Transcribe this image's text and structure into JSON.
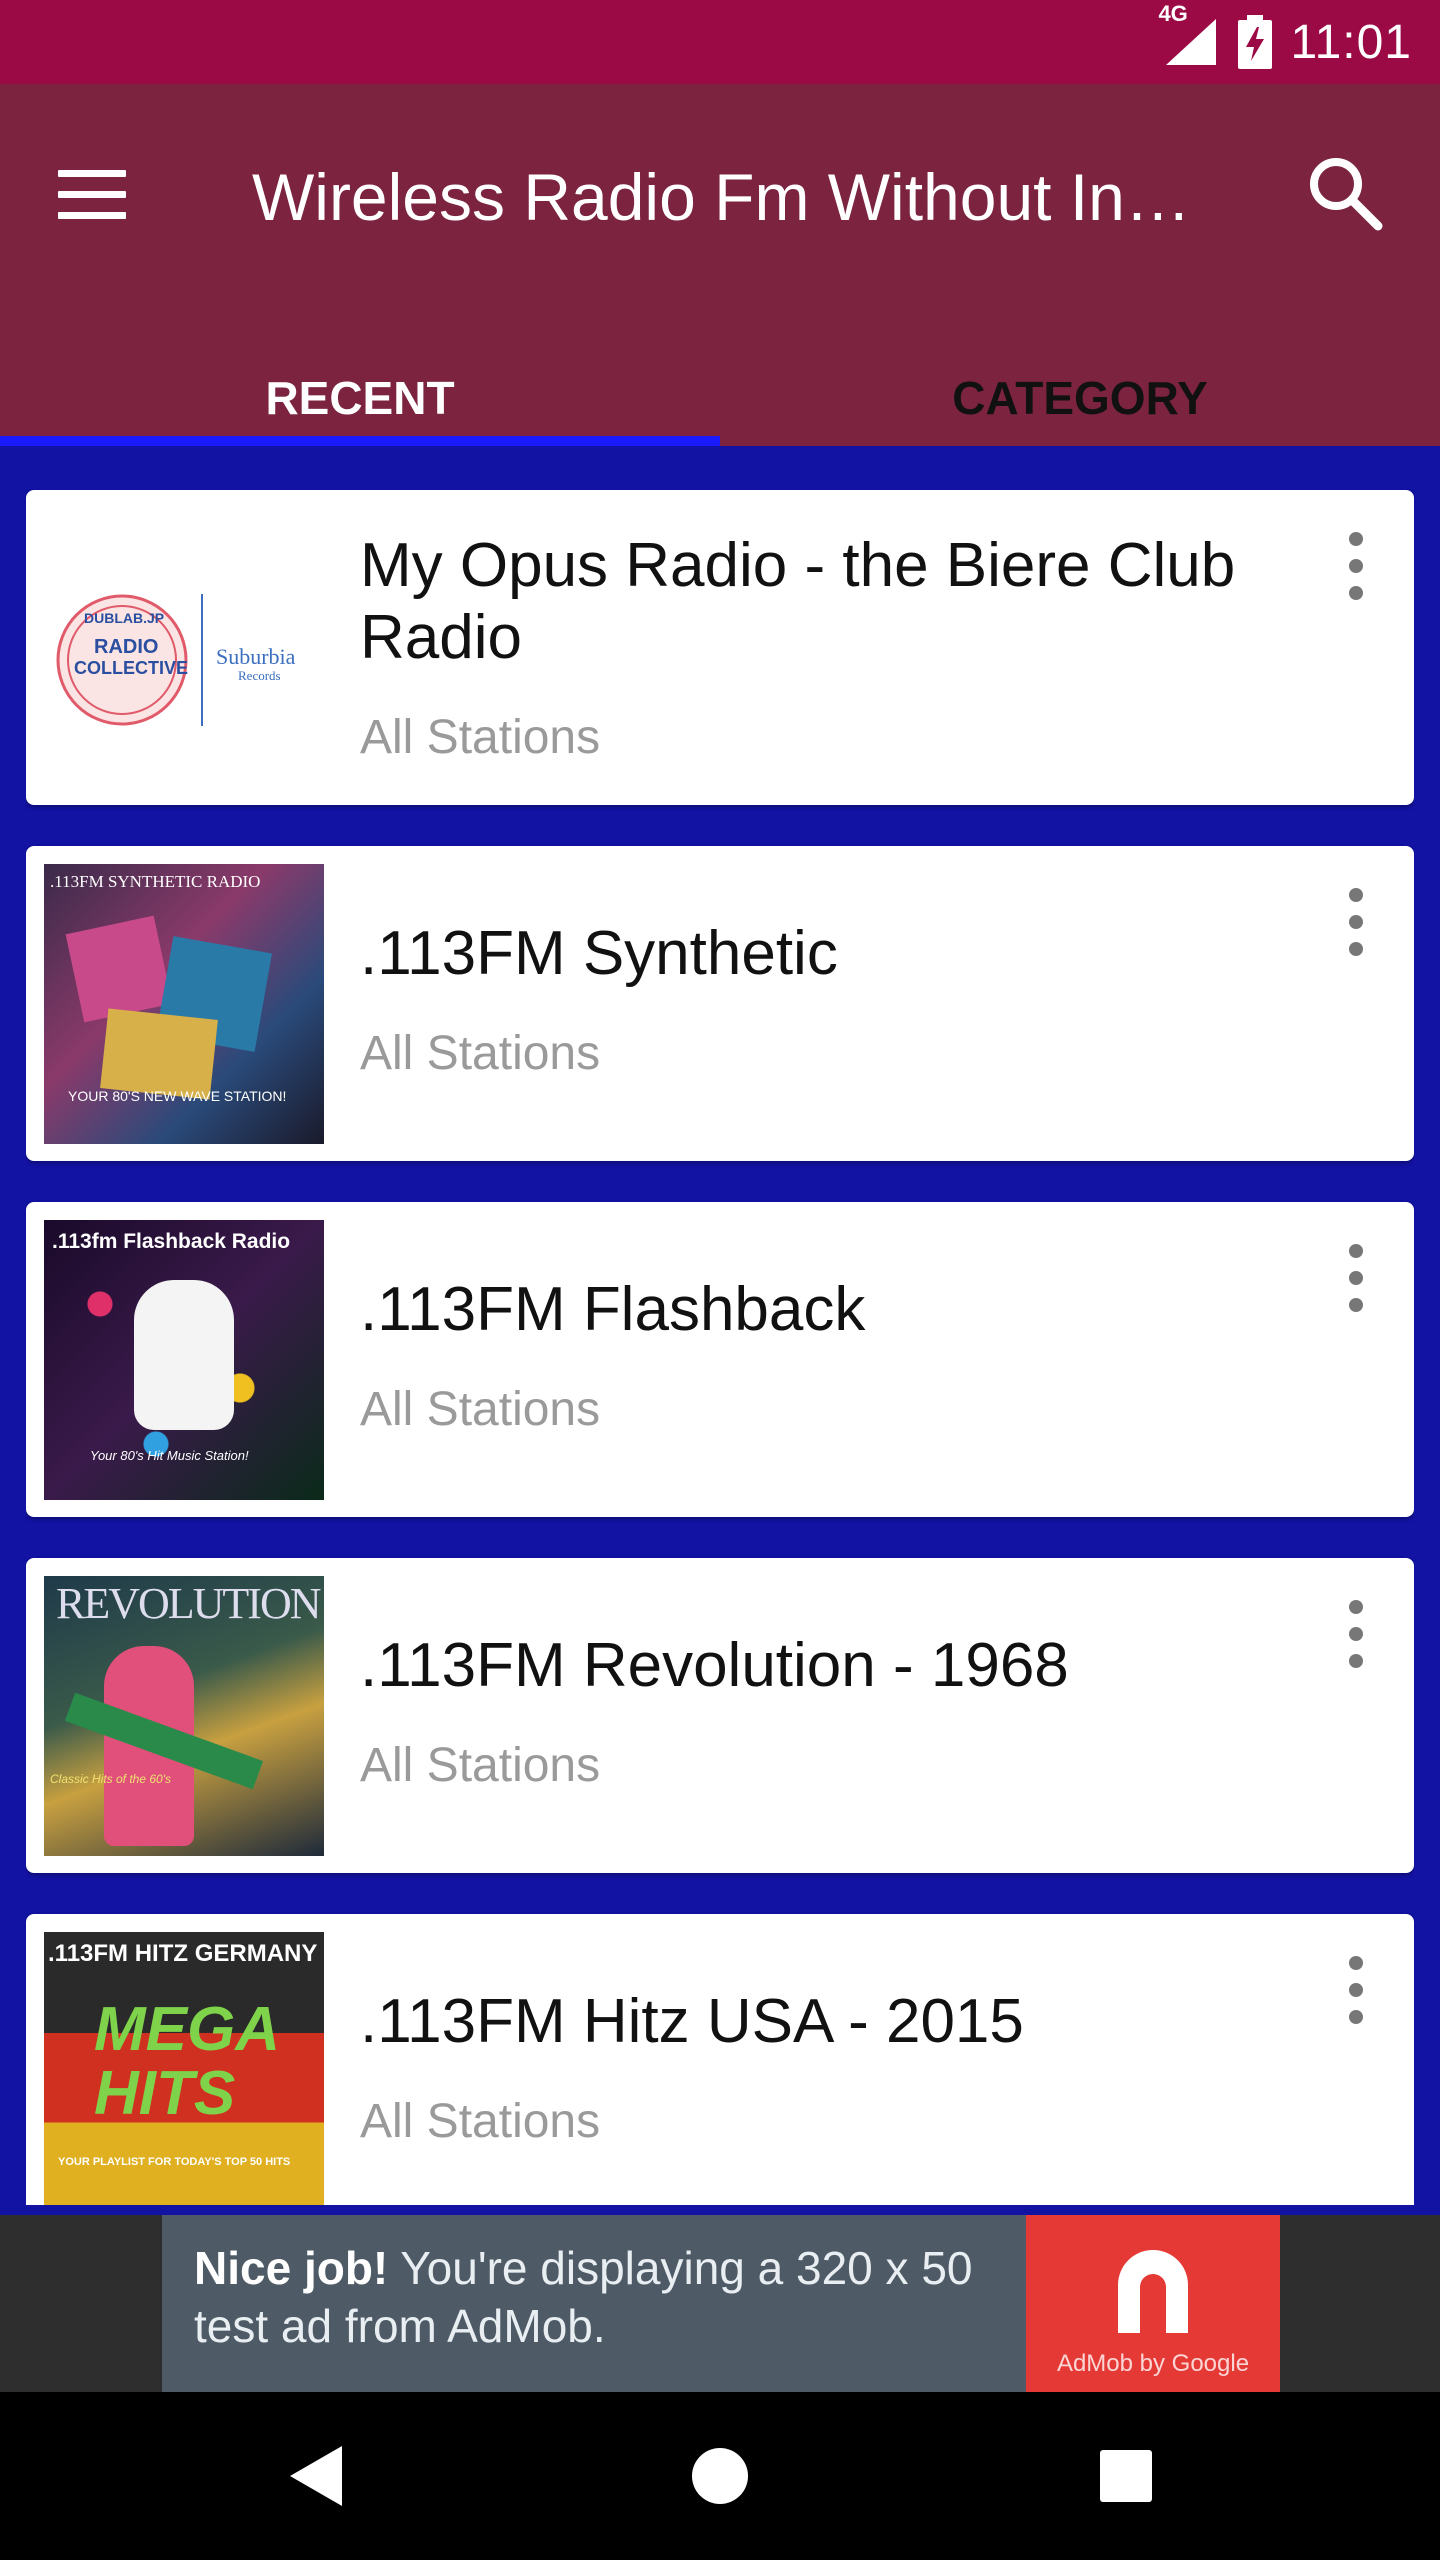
{
  "status_bar": {
    "network": "4G",
    "time": "11:01",
    "icons": [
      "signal-icon",
      "battery-charging-icon"
    ]
  },
  "app_bar": {
    "title": "Wireless Radio Fm Without In…",
    "menu_icon": "hamburger-menu-icon",
    "search_icon": "search-icon"
  },
  "tabs": [
    {
      "label": "RECENT",
      "selected": true
    },
    {
      "label": "CATEGORY",
      "selected": false
    }
  ],
  "stations": [
    {
      "title": "My Opus Radio - the Biere Club Radio",
      "subtitle": "All Stations",
      "thumb_text": "",
      "logo_text_1": "DUBLAB.JP",
      "logo_text_2": "RADIO",
      "logo_text_3": "COLLECTIVE",
      "logo_text_4": "Suburbia",
      "logo_text_5": "Records"
    },
    {
      "title": ".113FM Synthetic",
      "subtitle": "All Stations",
      "thumb_text": ".113FM SYNTHETIC RADIO",
      "thumb_caption": "YOUR 80'S NEW WAVE STATION!"
    },
    {
      "title": ".113FM Flashback",
      "subtitle": "All Stations",
      "thumb_text": ".113fm Flashback Radio",
      "thumb_caption": "Your 80's Hit Music Station!"
    },
    {
      "title": ".113FM Revolution - 1968",
      "subtitle": "All Stations",
      "thumb_text": "REVOLUTION",
      "thumb_caption": "Classic Hits of the 60's"
    },
    {
      "title": ".113FM Hitz USA - 2015",
      "subtitle": "All Stations",
      "thumb_text": ".113FM HITZ GERMANY",
      "thumb_caption": "YOUR PLAYLIST FOR TODAY'S TOP 50 HITS",
      "thumb_big": "MEGA HITS"
    }
  ],
  "ad": {
    "bold": "Nice job!",
    "text": " You're displaying a 320 x 50 test ad from AdMob.",
    "logo_text": "AdMob by Google"
  },
  "nav_bar": {
    "icons": [
      "back-icon",
      "home-icon",
      "recents-icon"
    ]
  },
  "colors": {
    "status_bar": "#9c0a45",
    "app_bar": "#7b233f",
    "background": "#1212a3",
    "tab_indicator": "#1a1aff"
  }
}
